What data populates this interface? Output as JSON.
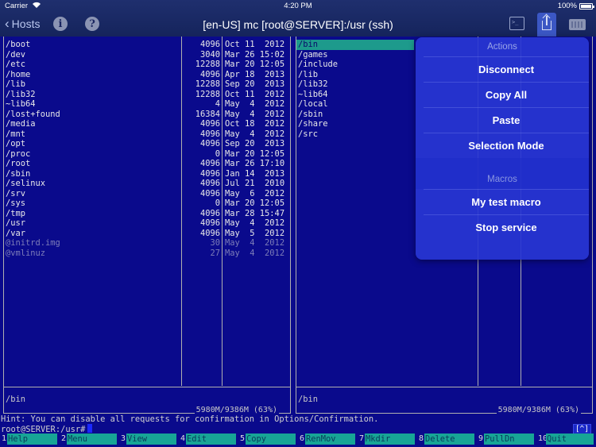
{
  "status_bar": {
    "carrier": "Carrier",
    "time": "4:20 PM",
    "battery": "100%"
  },
  "nav": {
    "back_label": "Hosts",
    "title": "[en-US] mc [root@SERVER]:/usr (ssh)"
  },
  "left_panel": {
    "rows": [
      {
        "name": "/boot",
        "size": "4096",
        "date": "Oct 11  2012"
      },
      {
        "name": "/dev",
        "size": "3040",
        "date": "Mar 26 15:02"
      },
      {
        "name": "/etc",
        "size": "12288",
        "date": "Mar 20 12:05"
      },
      {
        "name": "/home",
        "size": "4096",
        "date": "Apr 18  2013"
      },
      {
        "name": "/lib",
        "size": "12288",
        "date": "Sep 20  2013"
      },
      {
        "name": "/lib32",
        "size": "12288",
        "date": "Oct 11  2012"
      },
      {
        "name": "~lib64",
        "size": "4",
        "date": "May  4  2012"
      },
      {
        "name": "/lost+found",
        "size": "16384",
        "date": "May  4  2012"
      },
      {
        "name": "/media",
        "size": "4096",
        "date": "Oct 18  2012"
      },
      {
        "name": "/mnt",
        "size": "4096",
        "date": "May  4  2012"
      },
      {
        "name": "/opt",
        "size": "4096",
        "date": "Sep 20  2013"
      },
      {
        "name": "/proc",
        "size": "0",
        "date": "Mar 20 12:05"
      },
      {
        "name": "/root",
        "size": "4096",
        "date": "Mar 26 17:10"
      },
      {
        "name": "/sbin",
        "size": "4096",
        "date": "Jan 14  2013"
      },
      {
        "name": "/selinux",
        "size": "4096",
        "date": "Jul 21  2010"
      },
      {
        "name": "/srv",
        "size": "4096",
        "date": "May  6  2012"
      },
      {
        "name": "/sys",
        "size": "0",
        "date": "Mar 20 12:05"
      },
      {
        "name": "/tmp",
        "size": "4096",
        "date": "Mar 28 15:47"
      },
      {
        "name": "/usr",
        "size": "4096",
        "date": "May  4  2012"
      },
      {
        "name": "/var",
        "size": "4096",
        "date": "May  5  2012"
      },
      {
        "name": "@initrd.img",
        "size": "30",
        "date": "May  4  2012"
      },
      {
        "name": "@vmlinuz",
        "size": "27",
        "date": "May  4  2012"
      }
    ],
    "footer": "/bin",
    "stats": "5980M/9386M (63%)"
  },
  "right_panel": {
    "rows": [
      {
        "name": "/bin"
      },
      {
        "name": "/games"
      },
      {
        "name": "/include"
      },
      {
        "name": "/lib"
      },
      {
        "name": "/lib32"
      },
      {
        "name": "~lib64"
      },
      {
        "name": "/local"
      },
      {
        "name": "/sbin"
      },
      {
        "name": "/share"
      },
      {
        "name": "/src"
      }
    ],
    "footer": "/bin",
    "stats": "5980M/9386M (63%)"
  },
  "hint": "Hint: You can disable all requests for confirmation in Options/Confirmation.",
  "prompt": "root@SERVER:/usr#",
  "caret_button": "[^]",
  "function_keys": [
    {
      "num": "1",
      "label": "Help"
    },
    {
      "num": "2",
      "label": "Menu"
    },
    {
      "num": "3",
      "label": "View"
    },
    {
      "num": "4",
      "label": "Edit"
    },
    {
      "num": "5",
      "label": "Copy"
    },
    {
      "num": "6",
      "label": "RenMov"
    },
    {
      "num": "7",
      "label": "Mkdir"
    },
    {
      "num": "8",
      "label": "Delete"
    },
    {
      "num": "9",
      "label": "PullDn"
    },
    {
      "num": "10",
      "label": "Quit"
    }
  ],
  "popover": {
    "actions_header": "Actions",
    "actions": [
      "Disconnect",
      "Copy All",
      "Paste",
      "Selection Mode"
    ],
    "macros_header": "Macros",
    "macros": [
      "My test macro",
      "Stop service"
    ]
  }
}
